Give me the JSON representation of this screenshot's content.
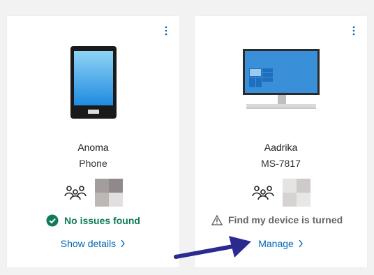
{
  "devices": [
    {
      "name": "Anoma",
      "model": "Phone",
      "status_text": "No issues found",
      "status_type": "ok",
      "link_label": "Show details",
      "device_icon": "phone-icon",
      "share_icon": "family-group-icon"
    },
    {
      "name": "Aadrika",
      "model": "MS-7817",
      "status_text": "Find my device is turned",
      "status_type": "warning",
      "link_label": "Manage",
      "device_icon": "desktop-monitor-icon",
      "share_icon": "family-group-icon"
    }
  ],
  "colors": {
    "background": "#f2f2f2",
    "card": "#ffffff",
    "ok_green": "#0f7b5a",
    "warning_gray": "#666666",
    "link_blue": "#0067b8",
    "annotation_arrow": "#2b2a8f"
  }
}
